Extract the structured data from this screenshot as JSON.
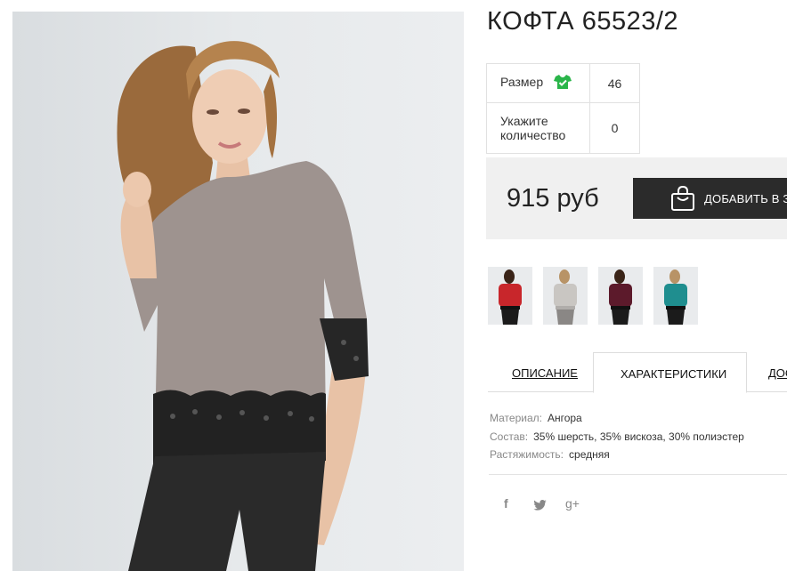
{
  "product": {
    "title": "КОФТА 65523/2"
  },
  "params": {
    "size_label": "Размер",
    "size_value": "46",
    "qty_label_line1": "Укажите",
    "qty_label_line2": "количество",
    "qty_value": "0"
  },
  "purchase": {
    "price": "915 руб",
    "add_to_cart_label": "ДОБАВИТЬ В ЗАКАЗ"
  },
  "thumbnails": [
    {
      "name": "red-variant",
      "color": "#c8262b"
    },
    {
      "name": "gray-variant",
      "color": "#c9c6c2"
    },
    {
      "name": "burgundy-variant",
      "color": "#5c1a2b"
    },
    {
      "name": "teal-variant",
      "color": "#1f8e8f"
    }
  ],
  "tabs": [
    {
      "label": "ОПИСАНИЕ"
    },
    {
      "label": "ХАРАКТЕРИСТИКИ"
    },
    {
      "label": "ДОСТАВКА"
    }
  ],
  "specs": [
    {
      "key": "Материал:",
      "value": "Ангора"
    },
    {
      "key": "Состав:",
      "value": "35% шерсть, 35% вискоза, 30% полиэстер"
    },
    {
      "key": "Растяжимость:",
      "value": "средняя"
    }
  ],
  "social": {
    "facebook": "f",
    "twitter": "twitter-icon",
    "google_plus": "g+"
  },
  "colors": {
    "size_icon": "#2ab54a",
    "button_bg": "#2b2b2b",
    "price_box_bg": "#f0f0f0"
  }
}
